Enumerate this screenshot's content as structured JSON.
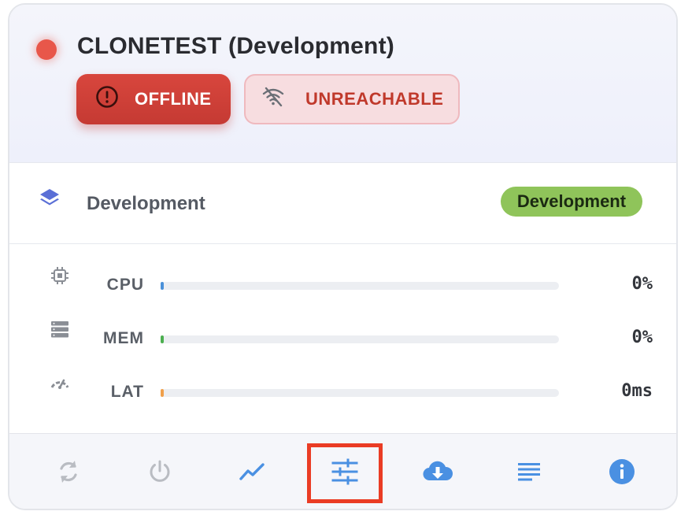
{
  "header": {
    "title": "CLONETEST (Development)",
    "status_color": "#e8574a",
    "badges": {
      "offline": {
        "label": "OFFLINE",
        "icon": "alert-circle-icon"
      },
      "unreachable": {
        "label": "UNREACHABLE",
        "icon": "wifi-off-icon"
      }
    }
  },
  "environment": {
    "icon": "layers-icon",
    "label": "Development",
    "tag": "Development",
    "tag_color": "#8fc45a"
  },
  "metrics": [
    {
      "key": "cpu",
      "icon": "cpu-icon",
      "label": "CPU",
      "value": "0%",
      "fraction": 0,
      "color": "#4a90d9"
    },
    {
      "key": "mem",
      "icon": "memory-icon",
      "label": "MEM",
      "value": "0%",
      "fraction": 0,
      "color": "#4caf50"
    },
    {
      "key": "lat",
      "icon": "speed-gauge-icon",
      "label": "LAT",
      "value": "0ms",
      "fraction": 0,
      "color": "#f0a04b"
    }
  ],
  "toolbar": {
    "items": [
      {
        "key": "restart",
        "icon": "restart-icon",
        "enabled": false
      },
      {
        "key": "power",
        "icon": "power-icon",
        "enabled": false
      },
      {
        "key": "stats",
        "icon": "chart-line-icon",
        "enabled": true
      },
      {
        "key": "settings",
        "icon": "sliders-icon",
        "enabled": true,
        "highlighted": true
      },
      {
        "key": "backup",
        "icon": "cloud-download-icon",
        "enabled": true
      },
      {
        "key": "logs",
        "icon": "logs-icon",
        "enabled": true
      },
      {
        "key": "info",
        "icon": "info-icon",
        "enabled": true
      }
    ],
    "highlight_color": "#ea3c24",
    "accent_color": "#4a90e2",
    "disabled_color": "#b9bcc2"
  }
}
